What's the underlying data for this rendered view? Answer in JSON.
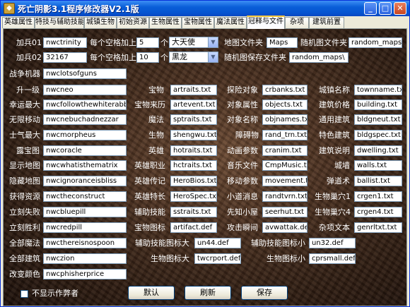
{
  "window": {
    "title": "死亡阴影3.1程序修改器V2.1版"
  },
  "tabs": [
    "英雄属性",
    "特技与辅助技能",
    "城镇生物",
    "初始资源",
    "生物属性",
    "宝物属性",
    "魔法属性",
    "冠释与文件",
    "杂项",
    "建筑前置"
  ],
  "active_tab": 7,
  "top": {
    "row1": {
      "label": "加兵01",
      "value": "nwctrinity",
      "per_grid": "每个空格加上",
      "count": "5",
      "unit": "个",
      "select": "大天使",
      "mapfolder_label": "地图文件夹",
      "mapfolder": "Maps",
      "randmap_label": "随机图文件夹",
      "randmap": "random_maps"
    },
    "row2": {
      "label": "加兵02",
      "value": "32167",
      "per_grid": "每个空格加上",
      "count": "10",
      "unit": "个",
      "select": "黑龙",
      "randsave_label": "随机图保存文件夹",
      "randsave": "random_maps\\"
    }
  },
  "cheats": [
    {
      "label": "战争机器",
      "value": "nwclotsofguns"
    },
    {
      "label": "升一级",
      "value": "nwcneo"
    },
    {
      "label": "幸运最大",
      "value": "nwcfollowthewhiterabbit"
    },
    {
      "label": "无限移动",
      "value": "nwcnebuchadnezzar"
    },
    {
      "label": "士气最大",
      "value": "nwcmorpheus"
    },
    {
      "label": "露宝图",
      "value": "nwcoracle"
    },
    {
      "label": "显示地图",
      "value": "nwcwhatisthematrix"
    },
    {
      "label": "隐藏地图",
      "value": "nwcignoranceisbliss"
    },
    {
      "label": "获得资源",
      "value": "nwctheconstruct"
    },
    {
      "label": "立刻失败",
      "value": "nwcbluepill"
    },
    {
      "label": "立刻胜利",
      "value": "nwcredpill"
    },
    {
      "label": "全部魔法",
      "value": "nwcthereisnospoon"
    },
    {
      "label": "全部建筑",
      "value": "nwczion"
    },
    {
      "label": "改变颜色",
      "value": "nwcphisherprice"
    }
  ],
  "files_col2": [
    {
      "label": "宝物",
      "value": "artraits.txt"
    },
    {
      "label": "宝物来历",
      "value": "artevent.txt"
    },
    {
      "label": "魔法",
      "value": "sptraits.txt"
    },
    {
      "label": "生物",
      "value": "shengwu.txt"
    },
    {
      "label": "英雄",
      "value": "hotraits.txt"
    },
    {
      "label": "英雄职业",
      "value": "hctraits.txt"
    },
    {
      "label": "英雄传记",
      "value": "HeroBios.txt"
    },
    {
      "label": "英雄特长",
      "value": "HeroSpec.txt"
    },
    {
      "label": "辅助技能",
      "value": "sstraits.txt"
    },
    {
      "label": "宝物图标",
      "value": "artifact.def"
    }
  ],
  "files_col3": [
    {
      "label": "探险对象",
      "value": "crbanks.txt"
    },
    {
      "label": "对象属性",
      "value": "objects.txt"
    },
    {
      "label": "对象名称",
      "value": "objnames.txt"
    },
    {
      "label": "障碍物",
      "value": "rand_trn.txt"
    },
    {
      "label": "动画参数",
      "value": "cranim.txt"
    },
    {
      "label": "音乐文件",
      "value": "CmpMusic.txt"
    },
    {
      "label": "移动参数",
      "value": "movement.txt"
    },
    {
      "label": "小道消息",
      "value": "randtvrn.txt"
    },
    {
      "label": "先知小屋",
      "value": "seerhut.txt"
    },
    {
      "label": "攻击瞬间",
      "value": "avwattak.def"
    }
  ],
  "files_col4": [
    {
      "label": "城镇名称",
      "value": "townname.txt"
    },
    {
      "label": "建筑价格",
      "value": "building.txt"
    },
    {
      "label": "通用建筑",
      "value": "bldgneut.txt"
    },
    {
      "label": "特色建筑",
      "value": "bldgspec.txt"
    },
    {
      "label": "建筑说明",
      "value": "dwelling.txt"
    },
    {
      "label": "城墙",
      "value": "walls.txt"
    },
    {
      "label": "弹道术",
      "value": "ballist.txt"
    },
    {
      "label": "生物巢穴1",
      "value": "crgen1.txt"
    },
    {
      "label": "生物巢穴4",
      "value": "crgen4.txt"
    },
    {
      "label": "杂项文本",
      "value": "genrltxt.txt"
    }
  ],
  "icons_row": {
    "skill_big_label": "辅助技能图标大",
    "skill_big": "un44.def",
    "skill_small_label": "辅助技能图标小",
    "skill_small": "un32.def",
    "crit_big_label": "生物图标大",
    "crit_big": "twcrport.def",
    "crit_small_label": "生物图标小",
    "crit_small": "cprsmall.def"
  },
  "footer": {
    "hide_author": "不显示作弊者",
    "default_btn": "默认",
    "refresh_btn": "刷新",
    "save_btn": "保存"
  },
  "colors": {
    "titlebar": "#0a5fd8",
    "panel_bg": "#3a2418",
    "text": "#ffffff"
  }
}
